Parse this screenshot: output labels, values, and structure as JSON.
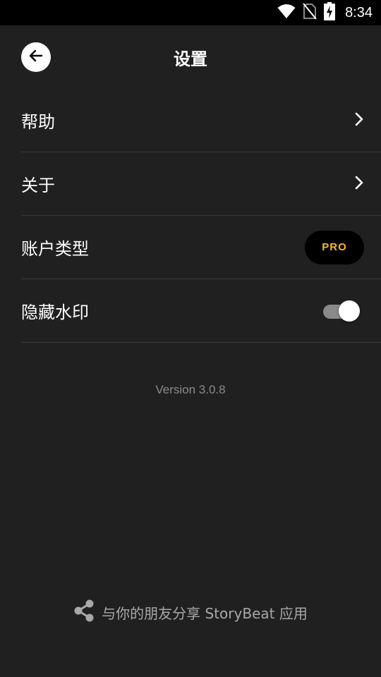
{
  "status_bar": {
    "time": "8:34",
    "icons": [
      "wifi-icon",
      "no-sim-icon",
      "battery-charging-icon"
    ]
  },
  "header": {
    "title": "设置",
    "back_icon": "arrow-left-icon"
  },
  "settings": {
    "help": {
      "label": "帮助",
      "trailing_icon": "chevron-right-icon"
    },
    "about": {
      "label": "关于",
      "trailing_icon": "chevron-right-icon"
    },
    "account_type": {
      "label": "账户类型",
      "badge": "PRO"
    },
    "hide_watermark": {
      "label": "隐藏水印",
      "toggle_on": true
    }
  },
  "version": "Version 3.0.8",
  "share": {
    "icon": "share-icon",
    "label": "与你的朋友分享 StoryBeat 应用"
  },
  "colors": {
    "background": "#202020",
    "status_bar": "#000000",
    "badge_text": "#f5b82e",
    "divider": "#3a3a3a"
  }
}
